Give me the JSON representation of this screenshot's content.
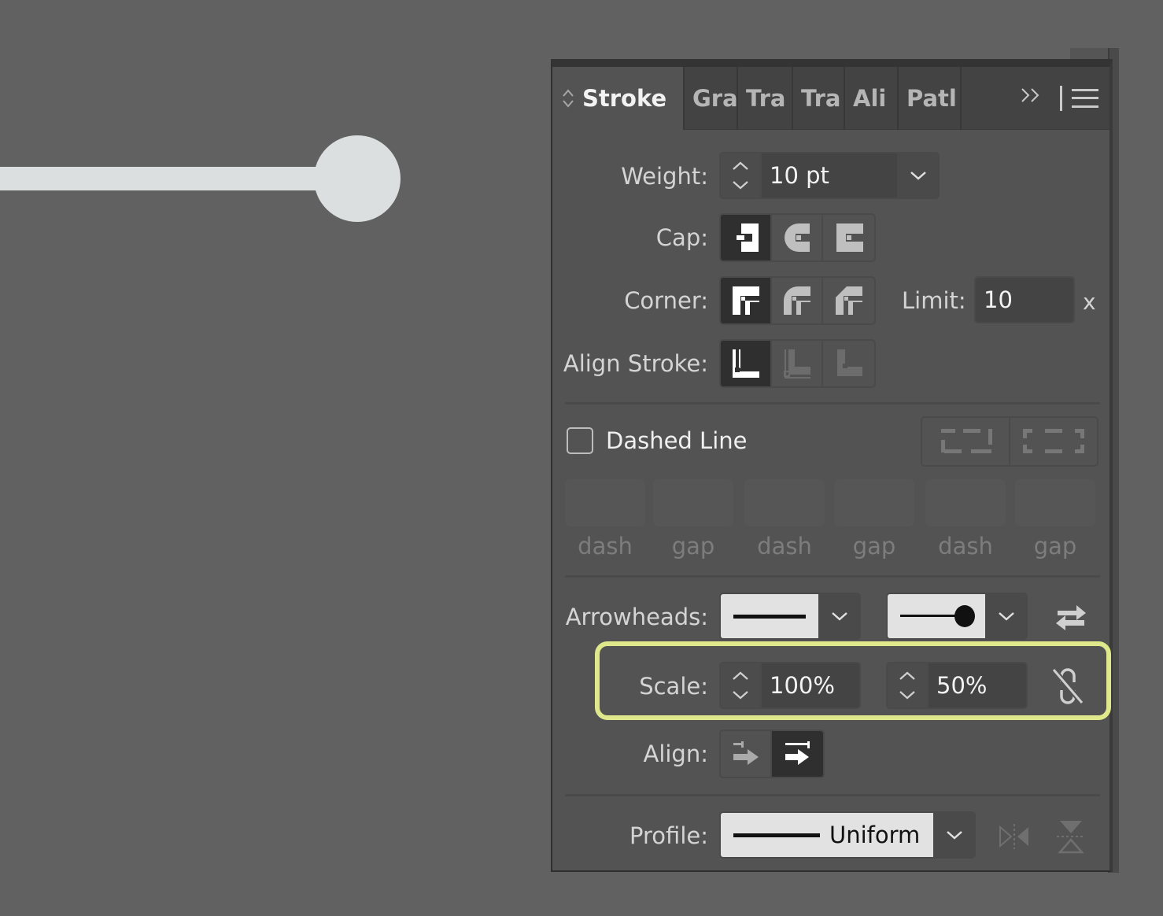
{
  "canvas": {
    "artwork": "stroke-with-round-end-arrowhead",
    "stroke_color": "#dcdfe0",
    "background_color": "#616161"
  },
  "panel": {
    "tabs": [
      {
        "label": "Stroke",
        "active": true
      },
      {
        "label": "Gra",
        "active": false
      },
      {
        "label": "Tra",
        "active": false
      },
      {
        "label": "Tra",
        "active": false
      },
      {
        "label": "Ali",
        "active": false
      },
      {
        "label": "Patl",
        "active": false
      }
    ],
    "overflow_label": "››",
    "weight": {
      "label": "Weight:",
      "value": "10 pt"
    },
    "cap": {
      "label": "Cap:",
      "options": [
        "butt-cap",
        "round-cap",
        "projecting-cap"
      ],
      "selected": 0
    },
    "corner": {
      "label": "Corner:",
      "options": [
        "miter-join",
        "round-join",
        "bevel-join"
      ],
      "selected": 0
    },
    "limit": {
      "label": "Limit:",
      "value": "10",
      "unit": "x"
    },
    "align_stroke": {
      "label": "Align Stroke:",
      "options": [
        "align-center",
        "align-inside",
        "align-outside"
      ],
      "selected": 0
    },
    "dashed_line": {
      "label": "Dashed Line",
      "checked": false
    },
    "dash_fields": [
      {
        "label": "dash",
        "value": ""
      },
      {
        "label": "gap",
        "value": ""
      },
      {
        "label": "dash",
        "value": ""
      },
      {
        "label": "gap",
        "value": ""
      },
      {
        "label": "dash",
        "value": ""
      },
      {
        "label": "gap",
        "value": ""
      }
    ],
    "arrowheads": {
      "label": "Arrowheads:",
      "start": "none",
      "end": "circle"
    },
    "scale": {
      "label": "Scale:",
      "start": "100%",
      "end": "50%",
      "linked": false
    },
    "align": {
      "label": "Align:",
      "options": [
        "extend-beyond-tip",
        "place-at-end"
      ],
      "selected": 1
    },
    "profile": {
      "label": "Profile:",
      "value": "Uniform"
    },
    "highlight_color": "#dfe88a"
  }
}
